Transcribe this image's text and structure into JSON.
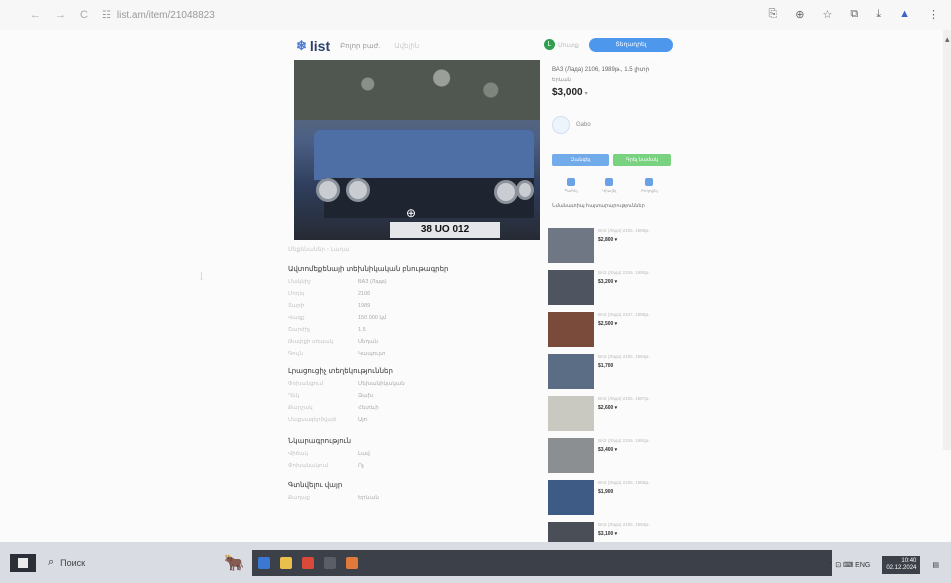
{
  "browser": {
    "back": "←",
    "forward": "→",
    "reload": "C",
    "address_icon": "☷",
    "url": "list.am/item/21048823",
    "toolbar_icons": [
      "translate-icon",
      "zoom-icon",
      "star-icon",
      "extensions-icon",
      "download-icon",
      "profile-icon",
      "menu-icon"
    ],
    "toolbar_glyphs": [
      "⎘",
      "⊕",
      "☆",
      "⧉",
      "⤓",
      "▲",
      "⋮"
    ]
  },
  "site": {
    "logo": "list",
    "logo_glyph": "❄",
    "nav_link": "Բոլոր բաժ.",
    "nav_link2": "Ավելին",
    "user_initial": "L",
    "user_label": "Մուտք",
    "post_button": "Տեղադրել հայտարարություն"
  },
  "listing": {
    "plate": "38 UO 012",
    "zoom_glyph": "⊕",
    "breadcrumb": "Մեքենաներ › Լադա",
    "section_main": "Ավտոմեքենայի տեխնիկական բնութագրեր",
    "specs": [
      {
        "k": "Մակնիշ",
        "v": "ВАЗ (Лада)"
      },
      {
        "k": "Մոդել",
        "v": "2106"
      },
      {
        "k": "Տարի",
        "v": "1989"
      },
      {
        "k": "Վազք",
        "v": "150 000 կմ"
      },
      {
        "k": "Շարժիչ",
        "v": "1.5"
      },
      {
        "k": "Թափքի տեսակ",
        "v": "Սեդան"
      },
      {
        "k": "Գույն",
        "v": "Կապույտ"
      }
    ],
    "section_extra": "Լրացուցիչ տեղեկություններ",
    "extra": [
      {
        "k": "Փոխանցում",
        "v": "Մեխանիկական"
      },
      {
        "k": "Ղեկ",
        "v": "Ձախ"
      },
      {
        "k": "Քարշակ",
        "v": "Հետևի"
      },
      {
        "k": "Մաքսազերծված",
        "v": "Այո"
      }
    ],
    "section_desc": "Նկարագրություն",
    "desc": [
      {
        "k": "Վիճակ",
        "v": "Լավ"
      },
      {
        "k": "Փոխանակում",
        "v": "Ոչ"
      }
    ],
    "section_location": "Գտնվելու վայր",
    "location": [
      {
        "k": "Քաղաք",
        "v": "Երևան"
      }
    ]
  },
  "sidebar": {
    "title": "ВАЗ (Лада) 2106, 1989թ., 1.5 լիտր",
    "location": "Երևան",
    "price": "$3,000",
    "price_suffix": "▾",
    "seller": "Gabo",
    "call_button": "Զանգել",
    "message_button": "Գրել նամակ",
    "actions": [
      "Պահել",
      "Կիսվել",
      "Բողոքել"
    ],
    "similar_title": "Նմանատիպ հայտարարություններ"
  },
  "similar": [
    {
      "title": "ВАЗ (Лада) 2106, 1988թ.",
      "price": "$2,800 ▾",
      "thumb": "#6f7784"
    },
    {
      "title": "ВАЗ (Лада) 2106, 1990թ.",
      "price": "$3,200 ▾",
      "thumb": "#4f5560"
    },
    {
      "title": "ВАЗ (Лада) 2107, 1995թ.",
      "price": "$2,500 ▾",
      "thumb": "#7a4b3a"
    },
    {
      "title": "ВАЗ (Лада) 2106, 1984թ.",
      "price": "$1,700",
      "thumb": "#5b6d85"
    },
    {
      "title": "ВАЗ (Лада) 2106, 1987թ.",
      "price": "$2,600 ▾",
      "thumb": "#c9c9c2"
    },
    {
      "title": "ВАЗ (Лада) 2106, 1991թ.",
      "price": "$3,400 ▾",
      "thumb": "#8c8f92"
    },
    {
      "title": "ВАЗ (Лада) 2106, 1986թ.",
      "price": "$1,900",
      "thumb": "#3e5b86"
    },
    {
      "title": "ВАЗ (Лада) 2106, 1993թ.",
      "price": "$3,100 ▾",
      "thumb": "#4a4f57"
    }
  ],
  "taskbar": {
    "search_placeholder": "Поиск",
    "search_glyph": "⌕",
    "bull_glyph": "🐂",
    "apps": [
      "#3a78d4",
      "#e8c04a",
      "#d94a3a",
      "#5a5e66",
      "#e07a3a"
    ],
    "tray_glyphs": "⌃ ⊡ ⌨ ENG",
    "time": "10:40",
    "date": "02.12.2024",
    "notif_glyph": "▤"
  }
}
